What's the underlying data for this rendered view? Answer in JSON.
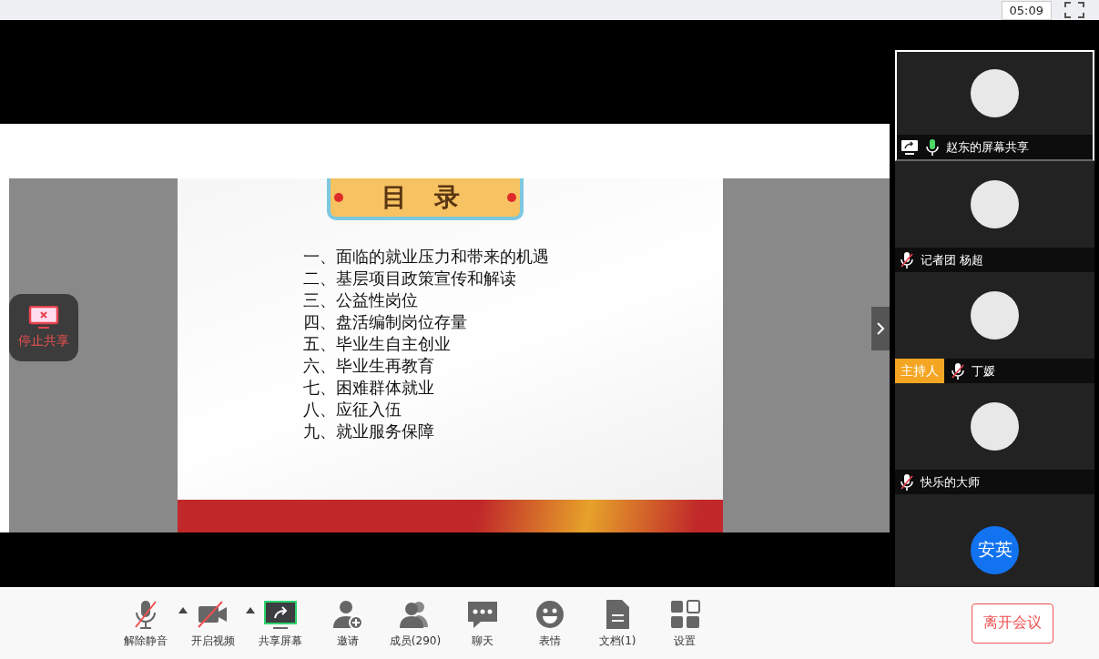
{
  "top_bar": {
    "timer": "05:09"
  },
  "slide": {
    "title": "目 录",
    "items": [
      "一、面临的就业压力和带来的机遇",
      "二、基层项目政策宣传和解读",
      "三、公益性岗位",
      "四、盘活编制岗位存量",
      "五、毕业生自主创业",
      "六、毕业生再教育",
      "七、困难群体就业",
      "八、应征入伍",
      "九、就业服务保障"
    ]
  },
  "stop_share": {
    "label": "停止共享"
  },
  "participants": [
    {
      "name": "赵东的屏幕共享",
      "sharing": true,
      "muted": false,
      "selected": true
    },
    {
      "name": "记者团 杨超",
      "sharing": false,
      "muted": true,
      "selected": false
    },
    {
      "name": "丁媛",
      "sharing": false,
      "muted": true,
      "host_badge": "主持人",
      "selected": false
    },
    {
      "name": "快乐的大师",
      "sharing": false,
      "muted": true,
      "selected": false
    },
    {
      "initials": "安英",
      "selected": false
    }
  ],
  "toolbar": [
    {
      "kind": "mic-off",
      "label": "解除静音",
      "menu": true
    },
    {
      "kind": "camera-off",
      "label": "开启视频",
      "menu": true
    },
    {
      "kind": "share",
      "label": "共享屏幕",
      "menu": false
    },
    {
      "kind": "invite",
      "label": "邀请",
      "menu": false
    },
    {
      "kind": "members",
      "label": "成员(290)",
      "menu": false
    },
    {
      "kind": "chat",
      "label": "聊天",
      "menu": false
    },
    {
      "kind": "emoji",
      "label": "表情",
      "menu": false
    },
    {
      "kind": "doc",
      "label": "文档(1)",
      "menu": false
    },
    {
      "kind": "settings",
      "label": "设置",
      "menu": false
    }
  ],
  "leave_button": "离开会议"
}
